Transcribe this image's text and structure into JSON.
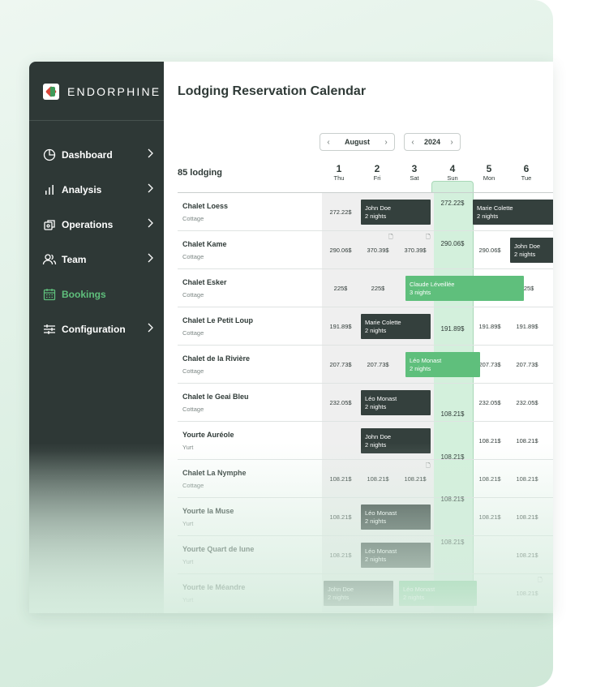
{
  "brand": {
    "name": "ENDORPHINE"
  },
  "nav": {
    "items": [
      {
        "label": "Dashboard",
        "icon": "pie-chart-icon",
        "has_chevron": true
      },
      {
        "label": "Analysis",
        "icon": "bar-chart-icon",
        "has_chevron": true
      },
      {
        "label": "Operations",
        "icon": "operations-icon",
        "has_chevron": true
      },
      {
        "label": "Team",
        "icon": "team-icon",
        "has_chevron": true
      },
      {
        "label": "Bookings",
        "icon": "calendar-icon",
        "has_chevron": false,
        "active": true
      },
      {
        "label": "Configuration",
        "icon": "sliders-icon",
        "has_chevron": true
      }
    ]
  },
  "page": {
    "title": "Lodging Reservation Calendar"
  },
  "controls": {
    "month": "August",
    "year": "2024"
  },
  "table": {
    "count_label": "85 lodging",
    "days": [
      {
        "num": "1",
        "wk": "Thu"
      },
      {
        "num": "2",
        "wk": "Fri"
      },
      {
        "num": "3",
        "wk": "Sat"
      },
      {
        "num": "4",
        "wk": "Sun"
      },
      {
        "num": "5",
        "wk": "Mon"
      },
      {
        "num": "6",
        "wk": "Tue"
      }
    ],
    "rows": [
      {
        "name": "Chalet Loess",
        "type": "Cottage"
      },
      {
        "name": "Chalet Kame",
        "type": "Cottage"
      },
      {
        "name": "Chalet Esker",
        "type": "Cottage"
      },
      {
        "name": "Chalet Le Petit Loup",
        "type": "Cottage"
      },
      {
        "name": "Chalet de la Rivière",
        "type": "Cottage"
      },
      {
        "name": "Chalet le Geai Bleu",
        "type": "Cottage"
      },
      {
        "name": "Yourte Auréole",
        "type": "Yurt"
      },
      {
        "name": "Chalet La Nymphe",
        "type": "Cottage"
      },
      {
        "name": "Yourte la Muse",
        "type": "Yurt"
      },
      {
        "name": "Yourte Quart de lune",
        "type": "Yurt"
      },
      {
        "name": "Yourte le Méandre",
        "type": "Yurt"
      }
    ],
    "prices": {
      "r0c1": "272.22$",
      "r1c1": "290.06$",
      "r1c2": "370.39$",
      "r1c3": "370.39$",
      "r1c5": "290.06$",
      "r2c1": "225$",
      "r2c2": "225$",
      "r2c6": "225$",
      "r3c1": "191.89$",
      "r3c5": "191.89$",
      "r3c6": "191.89$",
      "r4c1": "207.73$",
      "r4c2": "207.73$",
      "r4c5": "207.73$",
      "r4c6": "207.73$",
      "r5c1": "232.05$",
      "r5c5": "232.05$",
      "r5c6": "232.05$",
      "r6c5": "108.21$",
      "r6c6": "108.21$",
      "r7c1": "108.21$",
      "r7c2": "108.21$",
      "r7c3": "108.21$",
      "r7c5": "108.21$",
      "r7c6": "108.21$",
      "r8c1": "108.21$",
      "r8c5": "108.21$",
      "r8c6": "108.21$",
      "r9c1": "108.21$",
      "r9c6": "108.21$",
      "r10c3": "108.21$",
      "r10c6": "108.21$"
    },
    "sunday_prices": [
      "272.22$",
      "290.06$",
      "191.89$",
      "108.21$",
      "108.21$",
      "108.21$",
      "108.21$"
    ],
    "bookings": {
      "b0": {
        "guest": "John Doe",
        "nights": "2 nights"
      },
      "b1": {
        "guest": "Marie Colette",
        "nights": "2 nights"
      },
      "b2": {
        "guest": "John Doe",
        "nights": "2 nights"
      },
      "b3": {
        "guest": "Claude Léveillée",
        "nights": "3 nights"
      },
      "b4": {
        "guest": "Marie Colette",
        "nights": "2 nights"
      },
      "b5": {
        "guest": "Léo Monast",
        "nights": "2 nights"
      },
      "b6": {
        "guest": "Léo Monast",
        "nights": "2 nights"
      },
      "b7": {
        "guest": "John Doe",
        "nights": "2 nights"
      },
      "b8": {
        "guest": "Léo Monast",
        "nights": "2 nights"
      },
      "b9": {
        "guest": "Léo Monast",
        "nights": "2 nights"
      },
      "b10": {
        "guest": "John Doe",
        "nights": "2 nights"
      },
      "b11": {
        "guest": "Léo Monast",
        "nights": "2 nights"
      }
    }
  },
  "colors": {
    "sidebar": "#2e3836",
    "accent": "#5fbf7c",
    "booking_dark": "#34403d",
    "today_column": "#d3f0dc"
  }
}
